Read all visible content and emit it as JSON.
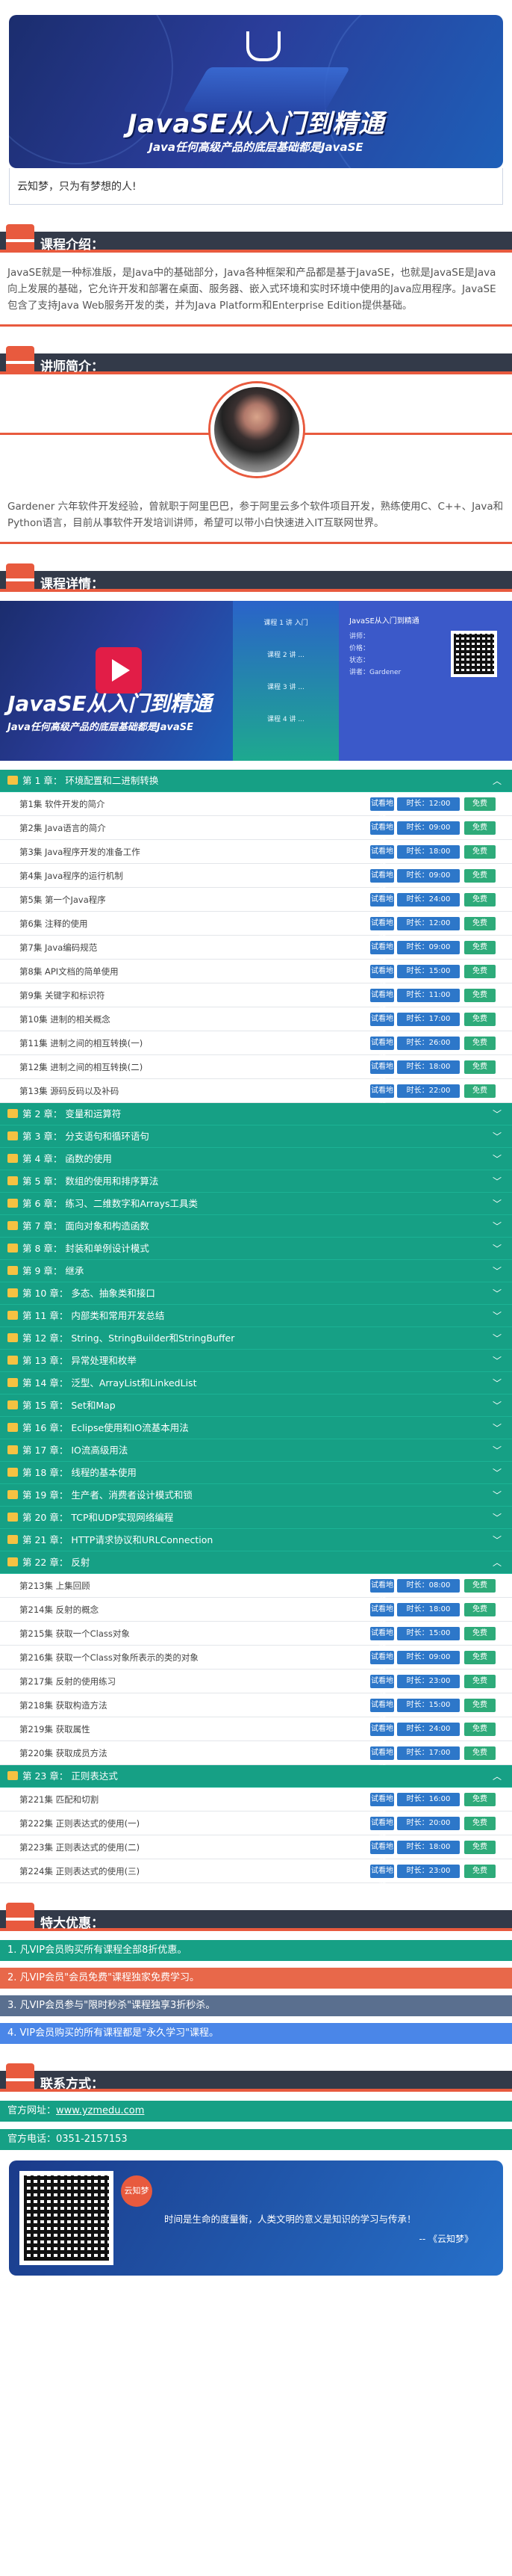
{
  "banner": {
    "title": "JavaSE从入门到精通",
    "subtitle": "Java任何高级产品的底层基础都是JavaSE"
  },
  "motto": "云知梦，只为有梦想的人!",
  "sections": {
    "intro": {
      "label": "课程介绍：",
      "text": "JavaSE就是一种标准版，是Java中的基础部分，Java各种框架和产品都是基于JavaSE，也就是JavaSE是Java向上发展的基础，它允许开发和部署在桌面、服务器、嵌入式环境和实时环境中使用的Java应用程序。JavaSE 包含了支持Java Web服务开发的类，并为Java Platform和Enterprise Edition提供基础。"
    },
    "teacher": {
      "label": "讲师简介：",
      "text": "Gardener 六年软件开发经验，曾就职于阿里巴巴，参于阿里云多个软件项目开发，熟练使用C、C++、Java和Python语言，目前从事软件开发培训讲师，希望可以带小白快速进入IT互联网世界。"
    },
    "detail": {
      "label": "课程详情："
    },
    "benefits": {
      "label": "特大优惠："
    },
    "contact": {
      "label": "联系方式："
    }
  },
  "course_img": {
    "title": "JavaSE从入门到精通",
    "subtitle": "Java任何高级产品的底层基础都是JavaSE",
    "card_title": "JavaSE从入门到精通",
    "mid": [
      "课程 1 讲 入门",
      "课程 2 讲 ...",
      "课程 3 讲 ...",
      "课程 4 讲 ..."
    ],
    "info": [
      "讲师：  ",
      "价格：  ",
      "状态：  ",
      "讲者：Gardener"
    ]
  },
  "tags": {
    "a": "试看地址",
    "c": "免费"
  },
  "chapters": [
    {
      "label": "第 1 章：  环境配置和二进制转换",
      "open": true,
      "lessons": [
        {
          "t": "第1集 软件开发的简介",
          "d": "时长：12:00"
        },
        {
          "t": "第2集 Java语言的简介",
          "d": "时长：09:00"
        },
        {
          "t": "第3集 Java程序开发的准备工作",
          "d": "时长：18:00"
        },
        {
          "t": "第4集 Java程序的运行机制",
          "d": "时长：09:00"
        },
        {
          "t": "第5集 第一个Java程序",
          "d": "时长：24:00"
        },
        {
          "t": "第6集 注释的使用",
          "d": "时长：12:00"
        },
        {
          "t": "第7集 Java编码规范",
          "d": "时长：09:00"
        },
        {
          "t": "第8集 API文档的简单使用",
          "d": "时长：15:00"
        },
        {
          "t": "第9集 关键字和标识符",
          "d": "时长：11:00"
        },
        {
          "t": "第10集 进制的相关概念",
          "d": "时长：17:00"
        },
        {
          "t": "第11集 进制之间的相互转换(一)",
          "d": "时长：26:00"
        },
        {
          "t": "第12集 进制之间的相互转换(二)",
          "d": "时长：18:00"
        },
        {
          "t": "第13集 源码反码以及补码",
          "d": "时长：22:00"
        }
      ]
    },
    {
      "label": "第 2 章：  变量和运算符",
      "open": false,
      "lessons": []
    },
    {
      "label": "第 3 章：  分支语句和循环语句",
      "open": false,
      "lessons": []
    },
    {
      "label": "第 4 章：  函数的使用",
      "open": false,
      "lessons": []
    },
    {
      "label": "第 5 章：  数组的使用和排序算法",
      "open": false,
      "lessons": []
    },
    {
      "label": "第 6 章：  练习、二维数字和Arrays工具类",
      "open": false,
      "lessons": []
    },
    {
      "label": "第 7 章：  面向对象和构造函数",
      "open": false,
      "lessons": []
    },
    {
      "label": "第 8 章：  封装和单例设计模式",
      "open": false,
      "lessons": []
    },
    {
      "label": "第 9 章：  继承",
      "open": false,
      "lessons": []
    },
    {
      "label": "第 10 章：  多态、抽象类和接口",
      "open": false,
      "lessons": []
    },
    {
      "label": "第 11 章：  内部类和常用开发总结",
      "open": false,
      "lessons": []
    },
    {
      "label": "第 12 章：  String、StringBuilder和StringBuffer",
      "open": false,
      "lessons": []
    },
    {
      "label": "第 13 章：  异常处理和枚举",
      "open": false,
      "lessons": []
    },
    {
      "label": "第 14 章：  泛型、ArrayList和LinkedList",
      "open": false,
      "lessons": []
    },
    {
      "label": "第 15 章：  Set和Map",
      "open": false,
      "lessons": []
    },
    {
      "label": "第 16 章：  Eclipse使用和IO流基本用法",
      "open": false,
      "lessons": []
    },
    {
      "label": "第 17 章：  IO流高级用法",
      "open": false,
      "lessons": []
    },
    {
      "label": "第 18 章：  线程的基本使用",
      "open": false,
      "lessons": []
    },
    {
      "label": "第 19 章：  生产者、消费者设计模式和锁",
      "open": false,
      "lessons": []
    },
    {
      "label": "第 20 章：  TCP和UDP实现网络编程",
      "open": false,
      "lessons": []
    },
    {
      "label": "第 21 章：  HTTP请求协议和URLConnection",
      "open": false,
      "lessons": []
    },
    {
      "label": "第 22 章：  反射",
      "open": true,
      "lessons": [
        {
          "t": "第213集 上集回顾",
          "d": "时长：08:00"
        },
        {
          "t": "第214集 反射的概念",
          "d": "时长：18:00"
        },
        {
          "t": "第215集 获取一个Class对象",
          "d": "时长：15:00"
        },
        {
          "t": "第216集 获取一个Class对象所表示的类的对象",
          "d": "时长：09:00"
        },
        {
          "t": "第217集 反射的使用练习",
          "d": "时长：23:00"
        },
        {
          "t": "第218集 获取构造方法",
          "d": "时长：15:00"
        },
        {
          "t": "第219集 获取属性",
          "d": "时长：24:00"
        },
        {
          "t": "第220集 获取成员方法",
          "d": "时长：17:00"
        }
      ]
    },
    {
      "label": "第 23 章：  正则表达式",
      "open": true,
      "lessons": [
        {
          "t": "第221集 匹配和切割",
          "d": "时长：16:00"
        },
        {
          "t": "第222集 正则表达式的使用(一)",
          "d": "时长：20:00"
        },
        {
          "t": "第223集 正则表达式的使用(二)",
          "d": "时长：18:00"
        },
        {
          "t": "第224集 正则表达式的使用(三)",
          "d": "时长：23:00"
        }
      ]
    }
  ],
  "benefits": [
    {
      "text": "1. 凡VIP会员购买所有课程全部8折优惠。",
      "color": "#16a085"
    },
    {
      "text": "2. 凡VIP会员\"会员免费\"课程独家免费学习。",
      "color": "#e8684a"
    },
    {
      "text": "3. 凡VIP会员参与\"限时秒杀\"课程独享3折秒杀。",
      "color": "#5a6f8f"
    },
    {
      "text": "4. VIP会员购买的所有课程都是\"永久学习\"课程。",
      "color": "#4a86e8"
    }
  ],
  "contact": {
    "site_label": "官方网址：",
    "site": "www.yzmedu.com",
    "phone_label": "官方电话：",
    "phone": "0351-2157153"
  },
  "footer": {
    "logo": "云知梦",
    "quote": "时间是生命的度量衡，人类文明的意义是知识的学习与传承！",
    "author": "-- 《云知梦》"
  }
}
